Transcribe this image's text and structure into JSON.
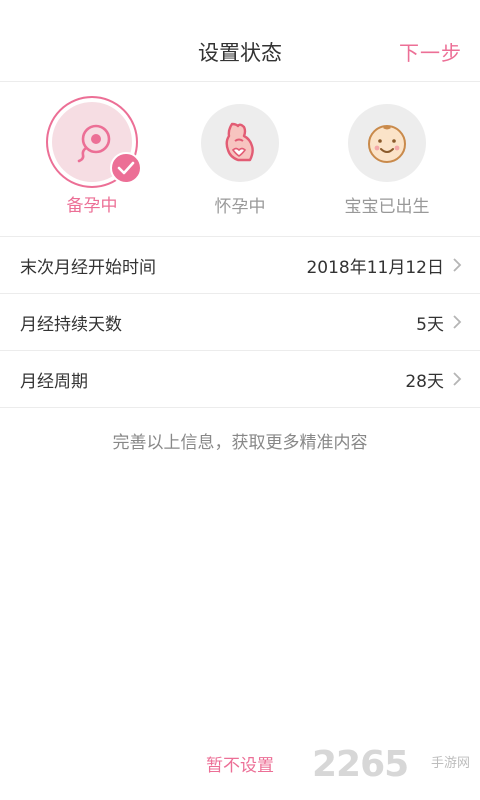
{
  "header": {
    "title": "设置状态",
    "next_label": "下一步"
  },
  "states": [
    {
      "label": "备孕中",
      "icon": "sperm-egg-icon",
      "selected": true
    },
    {
      "label": "怀孕中",
      "icon": "pregnant-belly-icon",
      "selected": false
    },
    {
      "label": "宝宝已出生",
      "icon": "baby-face-icon",
      "selected": false
    }
  ],
  "settings": [
    {
      "label": "末次月经开始时间",
      "value": "2018年11月12日"
    },
    {
      "label": "月经持续天数",
      "value": "5天"
    },
    {
      "label": "月经周期",
      "value": "28天"
    }
  ],
  "hint": "完善以上信息，获取更多精准内容",
  "skip_label": "暂不设置",
  "watermark": {
    "number": "2265",
    "text": "手游网"
  },
  "colors": {
    "accent": "#ec6f96",
    "divider": "#ececec",
    "muted": "#999999"
  }
}
